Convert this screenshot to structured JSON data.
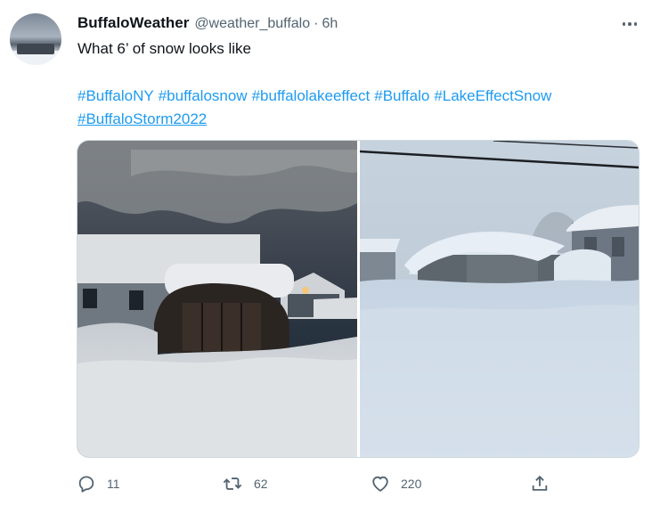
{
  "tweet": {
    "author_name": "BuffaloWeather",
    "author_handle": "@weather_buffalo",
    "separator": "·",
    "time": "6h",
    "text": "What 6’ of snow looks like",
    "hashtags": [
      "#BuffaloNY",
      "#buffalosnow",
      "#buffalolakeeffect",
      "#Buffalo",
      "#LakeEffectSnow"
    ],
    "hashtag_featured": "#BuffaloStorm2022"
  },
  "actions": {
    "reply_icon": "reply-icon",
    "reply_count": "11",
    "retweet_icon": "retweet-icon",
    "retweet_count": "62",
    "like_icon": "heart-icon",
    "like_count": "220",
    "share_icon": "share-icon"
  },
  "colors": {
    "link": "#1d9bf0",
    "secondary_text": "#536471",
    "primary_text": "#0f1419"
  }
}
